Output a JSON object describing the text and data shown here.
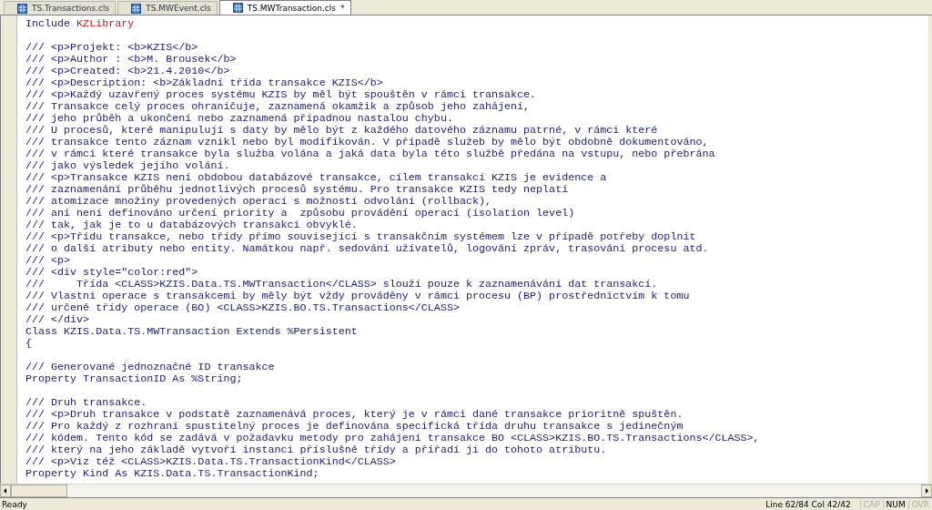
{
  "tabs": [
    {
      "label": "TS.Transactions.cls",
      "selected": false
    },
    {
      "label": "TS.MWEvent.cls",
      "selected": false
    },
    {
      "label": "TS.MWTransaction.cls",
      "selected": true,
      "modified_mark": "*"
    }
  ],
  "editor": {
    "lines": [
      {
        "kind": "code",
        "parts": [
          {
            "text": "Include ",
            "kind": "plain"
          },
          {
            "text": "KZLibrary",
            "kind": "macro"
          }
        ]
      },
      {
        "kind": "blank"
      },
      {
        "kind": "code",
        "parts": [
          {
            "text": "/// <p>Projekt: <b>KZIS</b>",
            "kind": "plain"
          }
        ]
      },
      {
        "kind": "code",
        "parts": [
          {
            "text": "/// <p>Author : <b>M. Brousek</b>",
            "kind": "plain"
          }
        ]
      },
      {
        "kind": "code",
        "parts": [
          {
            "text": "/// <p>Created: <b>21.4.2010</b>",
            "kind": "plain"
          }
        ]
      },
      {
        "kind": "code",
        "parts": [
          {
            "text": "/// <p>Description: <b>Základní třída transakce KZIS</b>",
            "kind": "plain"
          }
        ]
      },
      {
        "kind": "code",
        "parts": [
          {
            "text": "/// <p>Každý uzavřený proces systému KZIS by měl být spouštěn v rámci transakce.",
            "kind": "plain"
          }
        ]
      },
      {
        "kind": "code",
        "parts": [
          {
            "text": "/// Transakce celý proces ohraničuje, zaznamená okamžik a způsob jeho zahájení,",
            "kind": "plain"
          }
        ]
      },
      {
        "kind": "code",
        "parts": [
          {
            "text": "/// jeho průběh a ukončení nebo zaznamená případnou nastalou chybu.",
            "kind": "plain"
          }
        ]
      },
      {
        "kind": "code",
        "parts": [
          {
            "text": "/// U procesů, které manipulují s daty by mělo být z každého datového záznamu patrné, v rámci které",
            "kind": "plain"
          }
        ]
      },
      {
        "kind": "code",
        "parts": [
          {
            "text": "/// transakce tento záznam vznikl nebo byl modifikován. V případě služeb by mělo být obdobně dokumentováno,",
            "kind": "plain"
          }
        ]
      },
      {
        "kind": "code",
        "parts": [
          {
            "text": "/// v rámci které transakce byla služba volána a jaká data byla této službě předána na vstupu, nebo přebrána",
            "kind": "plain"
          }
        ]
      },
      {
        "kind": "code",
        "parts": [
          {
            "text": "/// jako výsledek jejího volání.",
            "kind": "plain"
          }
        ]
      },
      {
        "kind": "code",
        "parts": [
          {
            "text": "/// <p>Transakce KZIS není obdobou databázové transakce, cílem transakcí KZIS je evidence a",
            "kind": "plain"
          }
        ]
      },
      {
        "kind": "code",
        "parts": [
          {
            "text": "/// zaznamenání průběhu jednotlivých procesů systému. Pro transakce KZIS tedy neplatí",
            "kind": "plain"
          }
        ]
      },
      {
        "kind": "code",
        "parts": [
          {
            "text": "/// atomizace množiny provedených operací s možností odvolání (rollback),",
            "kind": "plain"
          }
        ]
      },
      {
        "kind": "code",
        "parts": [
          {
            "text": "/// ani není definováno určení priority a  způsobu provádění operací (isolation level)",
            "kind": "plain"
          }
        ]
      },
      {
        "kind": "code",
        "parts": [
          {
            "text": "/// tak, jak je to u databázových transakcí obvyklé.",
            "kind": "plain"
          }
        ]
      },
      {
        "kind": "code",
        "parts": [
          {
            "text": "/// <p>Třídu transakce, nebo třídy přímo související s transakčním systémem lze v případě potřeby doplnit",
            "kind": "plain"
          }
        ]
      },
      {
        "kind": "code",
        "parts": [
          {
            "text": "/// o další atributy nebo entity. Namátkou např. sedování uživatelů, logování zpráv, trasování procesu atd.",
            "kind": "plain"
          }
        ]
      },
      {
        "kind": "code",
        "parts": [
          {
            "text": "/// <p>",
            "kind": "plain"
          }
        ]
      },
      {
        "kind": "code",
        "parts": [
          {
            "text": "/// <div style=\"color:red\">",
            "kind": "plain"
          }
        ]
      },
      {
        "kind": "code",
        "parts": [
          {
            "text": "///     Třída <CLASS>KZIS.Data.TS.MWTransaction</CLASS> slouží pouze k zaznamenávání dat transakcí.",
            "kind": "plain"
          }
        ]
      },
      {
        "kind": "code",
        "parts": [
          {
            "text": "/// Vlastní operace s transakcemi by měly být vždy prováděny v rámci procesu (BP) prostřednictvím k tomu",
            "kind": "plain"
          }
        ]
      },
      {
        "kind": "code",
        "parts": [
          {
            "text": "/// určené třídy operace (BO) <CLASS>KZIS.BO.TS.Transactions</CLASS>",
            "kind": "plain"
          }
        ]
      },
      {
        "kind": "code",
        "parts": [
          {
            "text": "/// </div>",
            "kind": "plain"
          }
        ]
      },
      {
        "kind": "code",
        "parts": [
          {
            "text": "Class KZIS.Data.TS.MWTransaction Extends %Persistent",
            "kind": "plain"
          }
        ]
      },
      {
        "kind": "code",
        "parts": [
          {
            "text": "{",
            "kind": "plain"
          }
        ]
      },
      {
        "kind": "blank"
      },
      {
        "kind": "code",
        "parts": [
          {
            "text": "/// Generované jednoznačné ID transakce",
            "kind": "plain"
          }
        ]
      },
      {
        "kind": "code",
        "parts": [
          {
            "text": "Property TransactionID As %String;",
            "kind": "plain"
          }
        ]
      },
      {
        "kind": "blank"
      },
      {
        "kind": "code",
        "parts": [
          {
            "text": "/// Druh transakce.",
            "kind": "plain"
          }
        ]
      },
      {
        "kind": "code",
        "parts": [
          {
            "text": "/// <p>Druh transakce v podstatě zaznamenává proces, který je v rámci dané transakce prioritně spuštěn.",
            "kind": "plain"
          }
        ]
      },
      {
        "kind": "code",
        "parts": [
          {
            "text": "/// Pro každý z rozhraní spustitelný proces je definována specifická třída druhu transakce s jedinečným",
            "kind": "plain"
          }
        ]
      },
      {
        "kind": "code",
        "parts": [
          {
            "text": "/// kódem. Tento kód se zadává v požadavku metody pro zahájení transakce BO <CLASS>KZIS.BO.TS.Transactions</CLASS>,",
            "kind": "plain"
          }
        ]
      },
      {
        "kind": "code",
        "parts": [
          {
            "text": "/// který na jeho základě vytvoří instanci příslušné třídy a přiřadí ji do tohoto atributu.",
            "kind": "plain"
          }
        ]
      },
      {
        "kind": "code",
        "parts": [
          {
            "text": "/// <p>Viz též <CLASS>KZIS.Data.TS.TransactionKind</CLASS>",
            "kind": "plain"
          }
        ]
      },
      {
        "kind": "code",
        "parts": [
          {
            "text": "Property Kind As KZIS.Data.TS.TransactionKind;",
            "kind": "plain"
          }
        ]
      }
    ]
  },
  "status_bar": {
    "message": "Ready",
    "position": "Line 62/84 Col 42/42",
    "indicators": [
      {
        "label": "CAP",
        "on": false
      },
      {
        "label": "NUM",
        "on": true
      },
      {
        "label": "OVR",
        "on": false
      }
    ]
  }
}
